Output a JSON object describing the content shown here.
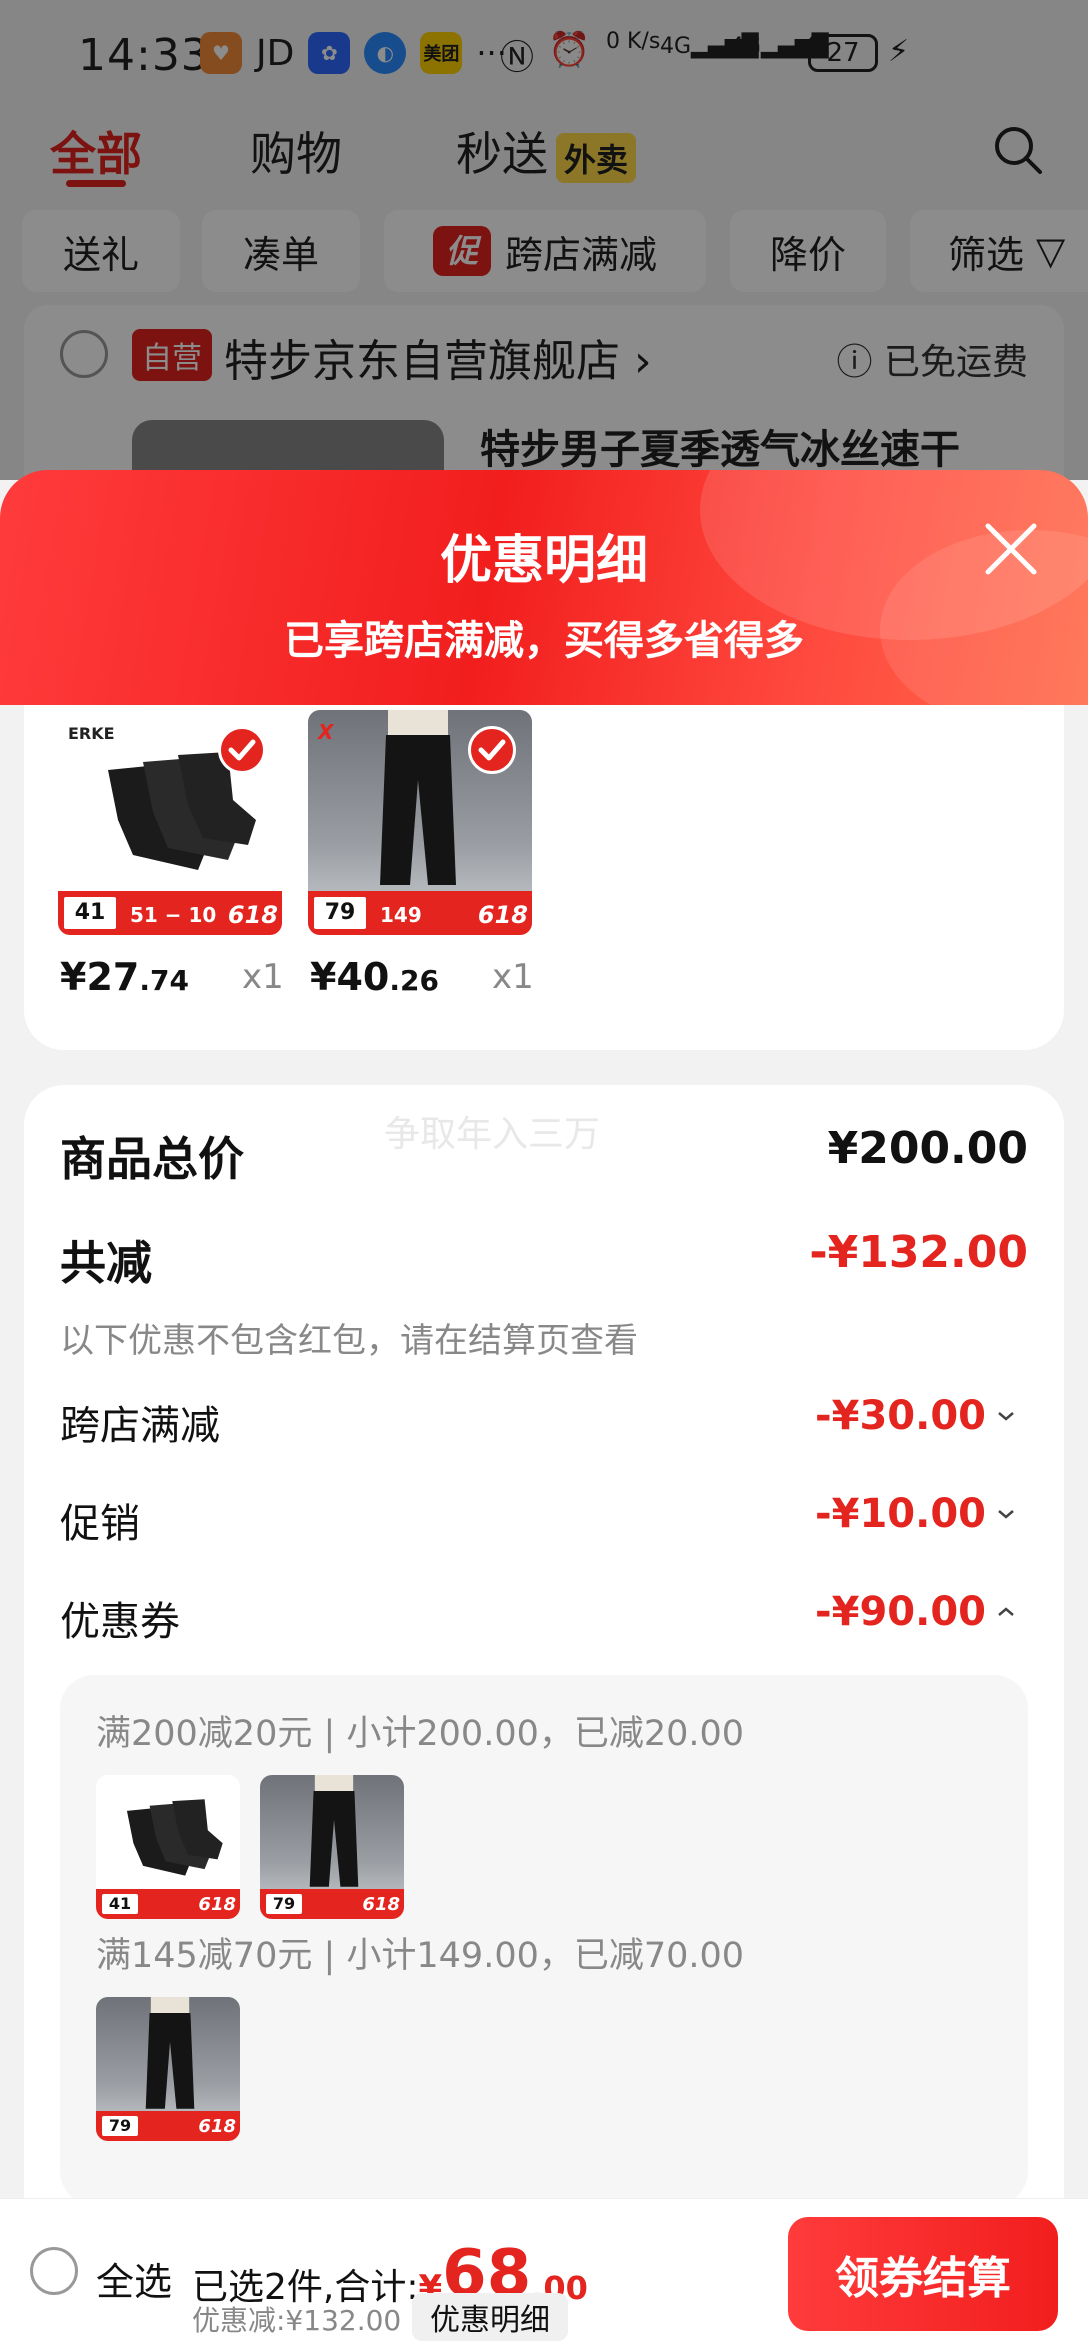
{
  "status_bar": {
    "time": "14:33",
    "jd_label": "JD",
    "meituan_label": "美团",
    "network": "0 K/s",
    "signal1": "4G",
    "signal2": "4G",
    "battery": "27"
  },
  "top_tabs": {
    "all": "全部",
    "shopping": "购物",
    "instant": "秒送",
    "waimai_badge": "外卖"
  },
  "filters": {
    "gift": "送礼",
    "bundle": "凑单",
    "promo_tag": "促",
    "cross_store": "跨店满减",
    "price_drop": "降价",
    "filter": "筛选"
  },
  "store": {
    "badge": "自营",
    "name": "特步京东自营旗舰店 ›",
    "free_shipping": "ⓘ 已免运费",
    "product_title": "特步男子夏季透气冰丝速干"
  },
  "sheet": {
    "title": "优惠明细",
    "subtitle": "已享跨店满减，买得多省得多"
  },
  "items": [
    {
      "brand": "ERKE",
      "price_int": "¥27",
      "price_dec": ".74",
      "qty": "x1",
      "badge_price": "41",
      "tag": "618"
    },
    {
      "brand": "X",
      "price_int": "¥40",
      "price_dec": ".26",
      "qty": "x1",
      "badge_price": "79",
      "tag": "618"
    }
  ],
  "summary": {
    "watermark": "争取年入三万",
    "total_label": "商品总价",
    "total_value": "¥200.00",
    "reduce_label": "共减",
    "reduce_value": "-¥132.00",
    "hint": "以下优惠不包含红包，请在结算页查看",
    "rows": [
      {
        "label": "跨店满减",
        "value": "-¥30.00",
        "expanded": false
      },
      {
        "label": "促销",
        "value": "-¥10.00",
        "expanded": false
      },
      {
        "label": "优惠券",
        "value": "-¥90.00",
        "expanded": true
      }
    ],
    "coupons": [
      {
        "text": "满200减20元 | 小计200.00，已减20.00"
      },
      {
        "text": "满145减70元 | 小计149.00，已减70.00"
      }
    ]
  },
  "bottom_bar": {
    "select_all": "全选",
    "selected_prefix": "已选2件,合计:",
    "total_sign": "¥",
    "total_int": "68",
    "total_dec": ".00",
    "discount": "优惠减:¥132.00",
    "detail_button": "优惠明细",
    "checkout": "领券结算"
  },
  "colors": {
    "accent": "#e3241f",
    "badge_yellow": "#ffd84a"
  }
}
